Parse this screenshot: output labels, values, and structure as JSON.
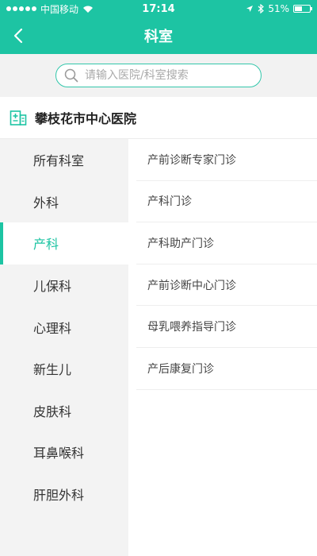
{
  "status_bar": {
    "carrier": "中国移动",
    "time": "17:14",
    "battery": "51%",
    "battery_level": 0.51
  },
  "header": {
    "title": "科室"
  },
  "search": {
    "placeholder": "请输入医院/科室搜索"
  },
  "hospital": {
    "name": "攀枝花市中心医院"
  },
  "departments": [
    {
      "label": "所有科室"
    },
    {
      "label": "外科"
    },
    {
      "label": "产科"
    },
    {
      "label": "儿保科"
    },
    {
      "label": "心理科"
    },
    {
      "label": "新生儿"
    },
    {
      "label": "皮肤科"
    },
    {
      "label": "耳鼻喉科"
    },
    {
      "label": "肝胆外科"
    }
  ],
  "selected_department": "产科",
  "clinics": [
    {
      "label": "产前诊断专家门诊"
    },
    {
      "label": "产科门诊"
    },
    {
      "label": "产科助产门诊"
    },
    {
      "label": "产前诊断中心门诊"
    },
    {
      "label": "母乳喂养指导门诊"
    },
    {
      "label": "产后康复门诊"
    }
  ],
  "colors": {
    "accent": "#1dc4a3",
    "sidebar_bg": "#f3f3f3"
  }
}
